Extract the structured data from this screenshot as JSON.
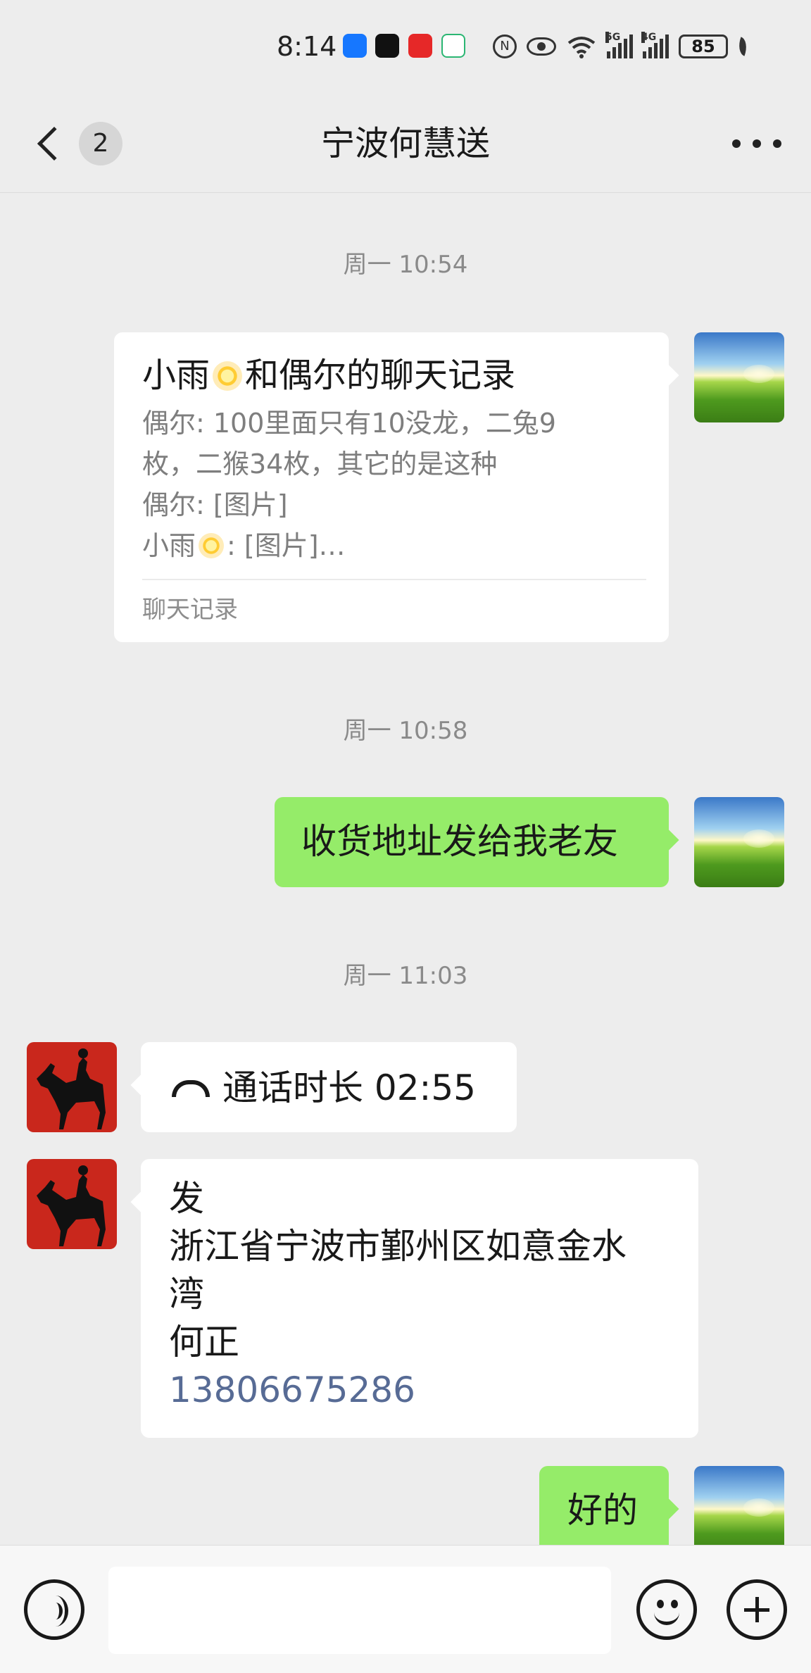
{
  "status_bar": {
    "time": "8:14",
    "battery": "85",
    "network_label_1": "5G",
    "network_label_2": "4G",
    "icon_names": [
      "alipay-icon",
      "tiktok-icon",
      "bank-icon",
      "mobile-carrier-icon",
      "nfc-icon",
      "eye-comfort-icon",
      "wifi-icon",
      "signal-5g-icon",
      "signal-4g-icon",
      "battery-icon",
      "power-saving-leaf-icon"
    ]
  },
  "header": {
    "unread_count": "2",
    "title": "宁波何慧送",
    "back_icon": "chevron-left-icon",
    "more_icon": "more-dots-icon"
  },
  "messages": {
    "ts1": "周一 10:54",
    "chat_record": {
      "title_part1": "小雨",
      "title_part2": "和偶尔的聊天记录",
      "line1": "偶尔: 100里面只有10没龙，二兔9",
      "line2": "枚，二猴34枚，其它的是这种",
      "line3": "偶尔: [图片]",
      "line4_part1": "小雨",
      "line4_part2": ": [图片]…",
      "footer": "聊天记录"
    },
    "ts2": "周一 10:58",
    "msg_sent1": "收货地址发给我老友",
    "ts3": "周一 11:03",
    "call": {
      "label": "通话时长 02:55",
      "icon": "phone-hangup-icon"
    },
    "address": {
      "line1": "发",
      "line2": "浙江省宁波市鄞州区如意金水",
      "line3": "湾",
      "line4": "何正",
      "phone": "13806675286"
    },
    "msg_sent2": "好的"
  },
  "input_bar": {
    "value": "",
    "voice_icon": "voice-icon",
    "emoji_icon": "emoji-icon",
    "plus_icon": "plus-icon"
  },
  "colors": {
    "background": "#ededed",
    "sent_bubble": "#95ec69",
    "received_bubble": "#ffffff",
    "link": "#576b95",
    "timestamp": "#8a8a8a"
  }
}
